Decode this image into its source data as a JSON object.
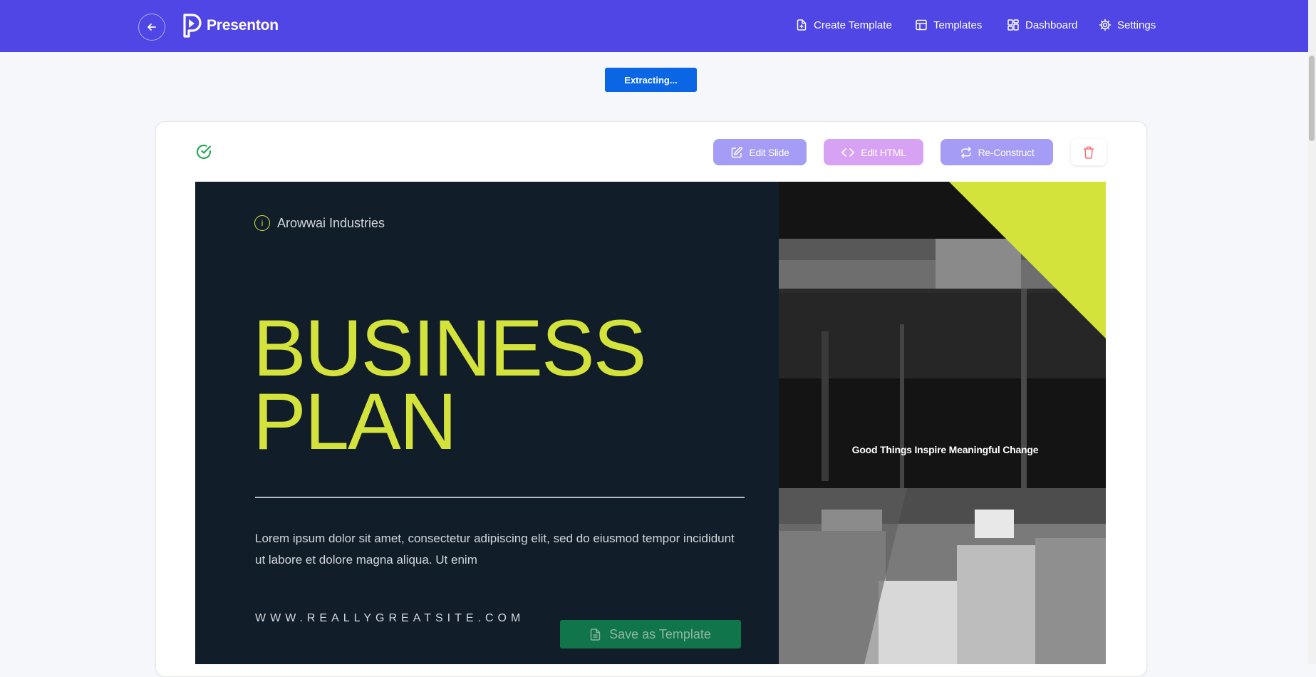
{
  "app": {
    "name": "Presenton"
  },
  "nav": {
    "items": [
      {
        "label": "Create Template",
        "icon": "file-plus-icon"
      },
      {
        "label": "Templates",
        "icon": "layout-icon"
      },
      {
        "label": "Dashboard",
        "icon": "grid-icon"
      },
      {
        "label": "Settings",
        "icon": "gear-icon"
      }
    ]
  },
  "status": {
    "extracting_label": "Extracting..."
  },
  "toolbar": {
    "edit_slide": "Edit Slide",
    "edit_html": "Edit HTML",
    "reconstruct": "Re-Construct"
  },
  "slide": {
    "company": "Arowwai Industries",
    "title_line1": "BUSINESS",
    "title_line2": "PLAN",
    "body": "Lorem ipsum dolor sit amet, consectetur adipiscing elit, sed do eiusmod tempor incididunt ut labore et dolore magna aliqua. Ut enim",
    "website": "WWW.REALLYGREATSITE.COM",
    "quote": "Good Things Inspire Meaningful Change"
  },
  "actions": {
    "save_template": "Save as Template"
  },
  "colors": {
    "header": "#4f46e5",
    "accent": "#d4e33b",
    "slide_bg": "#121d2a",
    "primary_button": "#0a66e4",
    "save_button": "#11754a"
  }
}
